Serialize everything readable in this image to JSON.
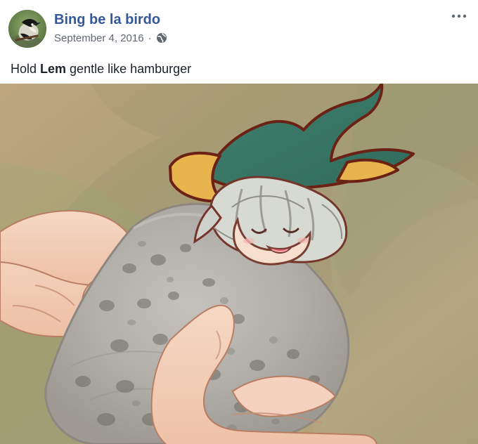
{
  "post": {
    "author": "Bing be la birdo",
    "date": "September 4, 2016",
    "separator": "·",
    "privacy_icon": "globe-icon",
    "more_icon": "more-options-icon",
    "caption": {
      "before": "Hold ",
      "highlight": "Lem",
      "after": " gentle like hamburger"
    },
    "image": {
      "semantic_name": "post-photo"
    }
  }
}
